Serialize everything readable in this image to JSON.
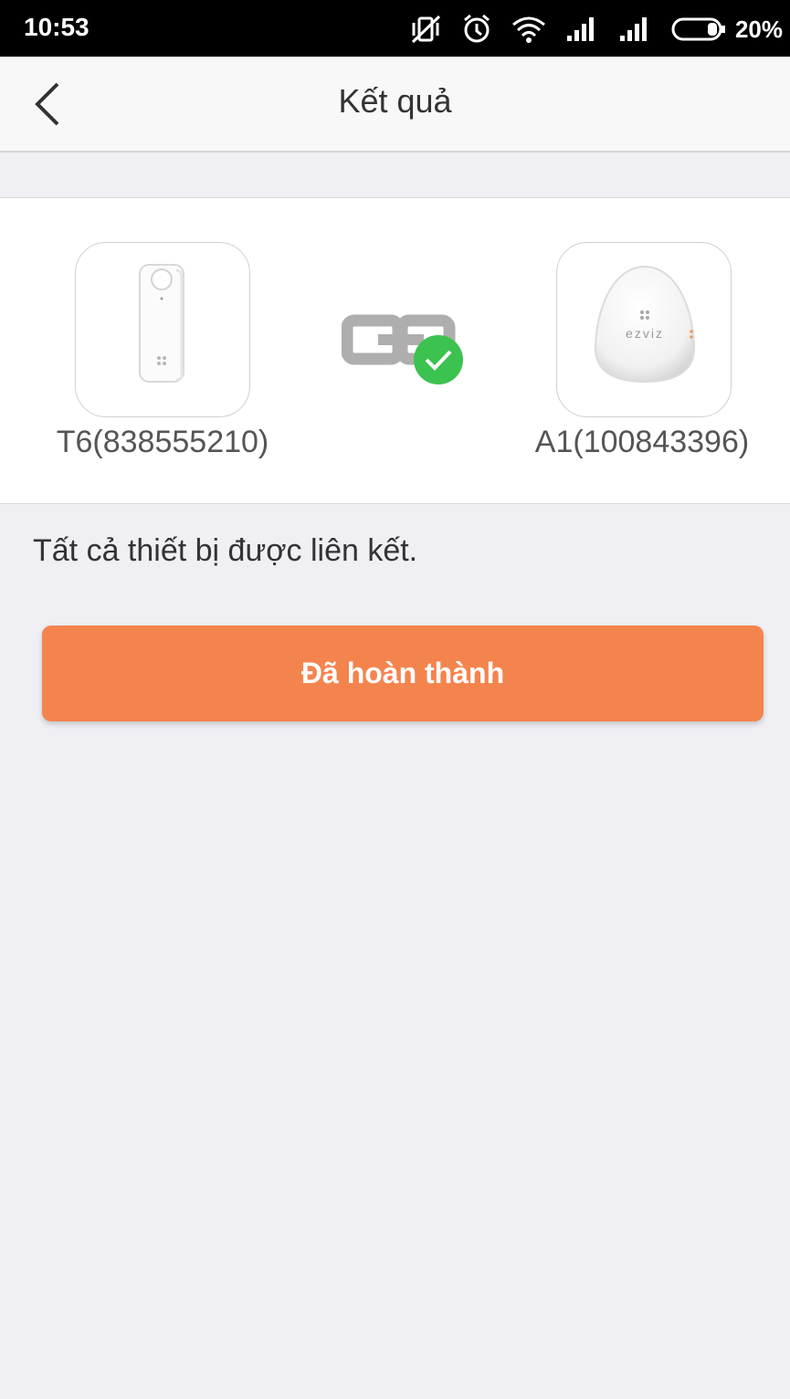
{
  "status_bar": {
    "time": "10:53",
    "battery": "20%",
    "icons": [
      "vibrate-off-icon",
      "alarm-icon",
      "wifi-icon",
      "signal-icon",
      "signal-icon",
      "battery-icon"
    ]
  },
  "header": {
    "title": "Kết quả",
    "back_icon": "chevron-left-icon"
  },
  "devices": {
    "left": {
      "label": "T6(838555210)",
      "image": "door-sensor"
    },
    "right": {
      "label": "A1(100843396)",
      "image": "ezviz-hub",
      "brand": "ezviz"
    },
    "link_icon": "link-icon",
    "success_icon": "check-circle-icon"
  },
  "message": "Tất cả thiết bị được liên kết.",
  "primary_button": "Đã hoàn thành",
  "colors": {
    "accent": "#f4844e",
    "success": "#3cc24f",
    "background": "#efeff4"
  }
}
